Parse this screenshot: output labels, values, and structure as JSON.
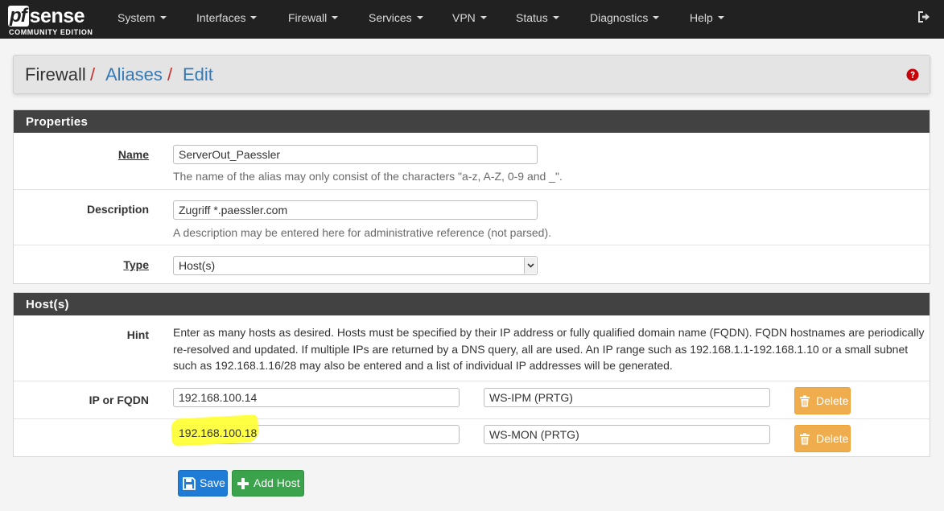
{
  "brand": {
    "name_pf": "pf",
    "name_sense": "sense",
    "edition": "COMMUNITY EDITION"
  },
  "nav": {
    "items": [
      {
        "label": "System"
      },
      {
        "label": "Interfaces"
      },
      {
        "label": "Firewall"
      },
      {
        "label": "Services"
      },
      {
        "label": "VPN"
      },
      {
        "label": "Status"
      },
      {
        "label": "Diagnostics"
      },
      {
        "label": "Help"
      }
    ],
    "logout_icon": "sign-out-icon"
  },
  "breadcrumb": {
    "root": "Firewall",
    "sep": "/",
    "aliases": "Aliases",
    "edit": "Edit",
    "help_icon": "question-circle-icon"
  },
  "properties": {
    "title": "Properties",
    "name": {
      "label": "Name",
      "value": "ServerOut_Paessler",
      "help": "The name of the alias may only consist of the characters \"a-z, A-Z, 0-9 and _\"."
    },
    "description": {
      "label": "Description",
      "value": "Zugriff *.paessler.com",
      "help": "A description may be entered here for administrative reference (not parsed)."
    },
    "type": {
      "label": "Type",
      "value": "Host(s)"
    }
  },
  "hosts": {
    "title": "Host(s)",
    "hint_label": "Hint",
    "hint_text": "Enter as many hosts as desired. Hosts must be specified by their IP address or fully qualified domain name (FQDN). FQDN hostnames are periodically re-resolved and updated. If multiple IPs are returned by a DNS query, all are used. An IP range such as 192.168.1.1-192.168.1.10 or a small subnet such as 192.168.1.16/28 may also be entered and a list of individual IP addresses will be generated.",
    "ip_label": "IP or FQDN",
    "rows": [
      {
        "ip": "192.168.100.14",
        "desc": "WS-IPM (PRTG)",
        "delete": "Delete"
      },
      {
        "ip": "192.168.100.18",
        "desc": "WS-MON (PRTG)",
        "delete": "Delete"
      }
    ]
  },
  "actions": {
    "save": "Save",
    "add_host": "Add Host"
  },
  "colors": {
    "navbar": "#212121",
    "panel_header": "#424242",
    "link": "#337ab7",
    "separator": "#c9302c",
    "delete": "#f0ad4e",
    "save": "#1e7bd6",
    "add": "#3aa34b",
    "highlight": "#ffff33"
  }
}
